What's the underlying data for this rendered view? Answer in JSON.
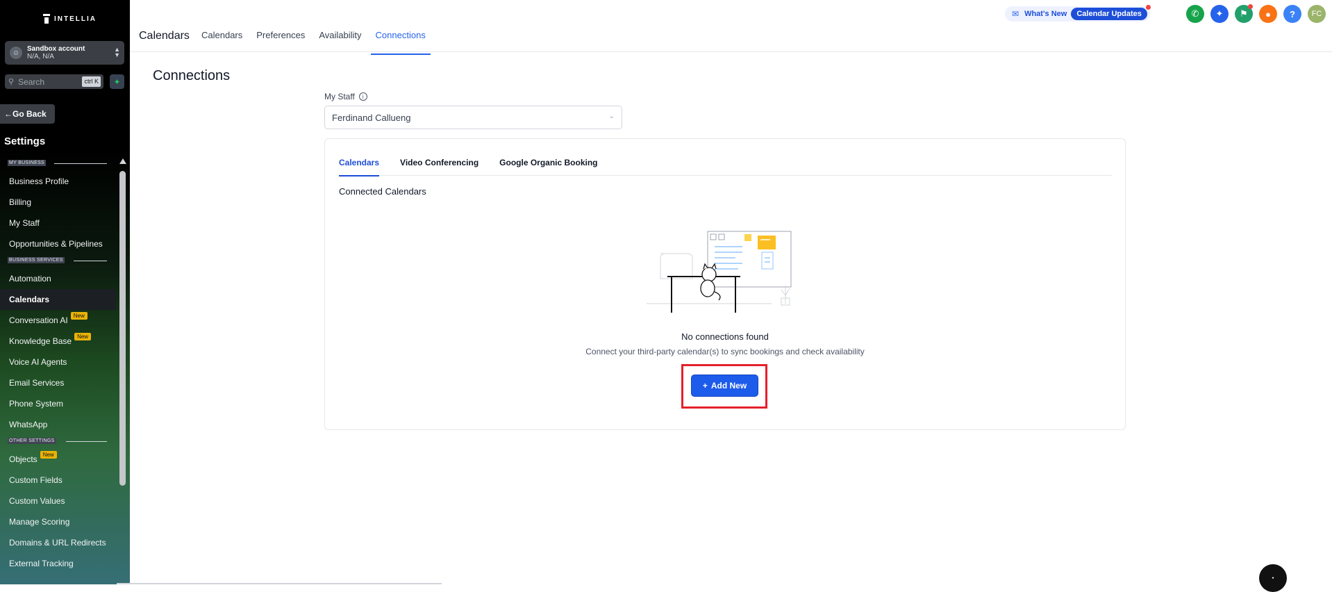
{
  "sidebar": {
    "logo": "INTELLIA",
    "account": {
      "name": "Sandbox account",
      "sub": "N/A, N/A"
    },
    "search": {
      "placeholder": "Search",
      "shortcut": "ctrl K"
    },
    "go_back": "Go Back",
    "settings_title": "Settings",
    "sections": {
      "my_business": "MY BUSINESS",
      "business_services": "BUSINESS SERVICES",
      "other_settings": "OTHER SETTINGS"
    },
    "items": [
      {
        "label": "Business Profile"
      },
      {
        "label": "Billing"
      },
      {
        "label": "My Staff"
      },
      {
        "label": "Opportunities & Pipelines"
      },
      {
        "label": "Automation"
      },
      {
        "label": "Calendars"
      },
      {
        "label": "Conversation AI",
        "badge": "New"
      },
      {
        "label": "Knowledge Base",
        "badge": "New"
      },
      {
        "label": "Voice AI Agents"
      },
      {
        "label": "Email Services"
      },
      {
        "label": "Phone System"
      },
      {
        "label": "WhatsApp"
      },
      {
        "label": "Objects",
        "badge": "New"
      },
      {
        "label": "Custom Fields"
      },
      {
        "label": "Custom Values"
      },
      {
        "label": "Manage Scoring"
      },
      {
        "label": "Domains & URL Redirects"
      },
      {
        "label": "External Tracking"
      }
    ]
  },
  "header": {
    "title": "Calendars",
    "tabs": [
      "Calendars",
      "Preferences",
      "Availability",
      "Connections"
    ],
    "whats_new": "What's New",
    "calendar_updates": "Calendar Updates",
    "avatar": "FC",
    "help": "?"
  },
  "main": {
    "title": "Connections",
    "staff_label": "My Staff",
    "staff_value": "Ferdinand Callueng",
    "card_tabs": [
      "Calendars",
      "Video Conferencing",
      "Google Organic Booking"
    ],
    "connected_title": "Connected Calendars",
    "empty_title": "No connections found",
    "empty_sub": "Connect your third-party calendar(s) to sync bookings and check availability",
    "add_button": "Add New"
  },
  "colors": {
    "accent": "#2563eb",
    "primary_button": "#1d5bea",
    "highlight": "#e5202b",
    "phone": "#16a34a",
    "sparkle": "#2563eb",
    "megaphone": "#22a06b",
    "bell": "#f97316",
    "help": "#3b82f6",
    "avatar": "#9ab46a"
  }
}
